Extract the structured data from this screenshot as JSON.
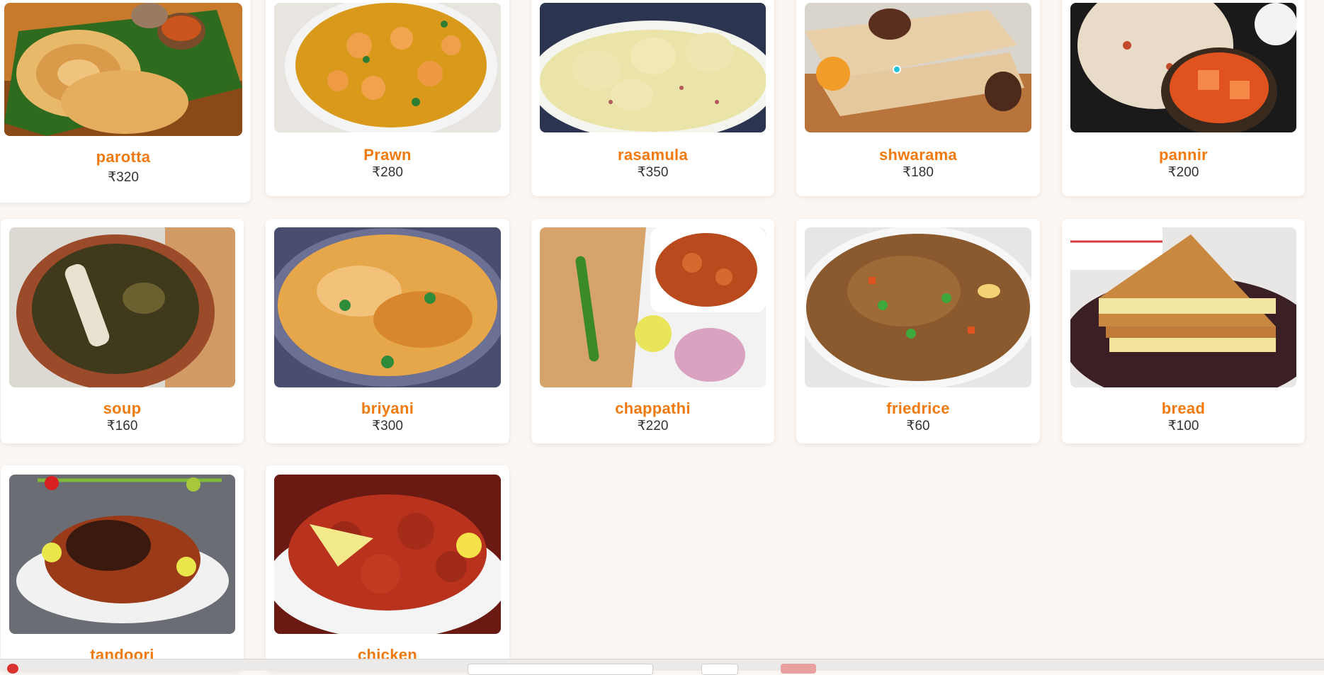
{
  "menu": {
    "currency_symbol": "₹",
    "accent_color": "#f07a10",
    "items": [
      {
        "name": "parotta",
        "price": "₹320",
        "image": "parotta-photo"
      },
      {
        "name": "Prawn",
        "price": "₹280",
        "image": "prawn-curry-photo"
      },
      {
        "name": "rasamula",
        "price": "₹350",
        "image": "rasmalai-photo"
      },
      {
        "name": "shwarama",
        "price": "₹180",
        "image": "shawarma-wrap-photo"
      },
      {
        "name": "pannir",
        "price": "₹200",
        "image": "paneer-naan-photo"
      },
      {
        "name": "soup",
        "price": "₹160",
        "image": "mutton-soup-photo"
      },
      {
        "name": "briyani",
        "price": "₹300",
        "image": "biryani-photo"
      },
      {
        "name": "chappathi",
        "price": "₹220",
        "image": "chapati-curry-photo"
      },
      {
        "name": "friedrice",
        "price": "₹60",
        "image": "fried-rice-photo"
      },
      {
        "name": "bread",
        "price": "₹100",
        "image": "sandwich-photo"
      },
      {
        "name": "tandoori",
        "price": "",
        "image": "tandoori-chicken-photo"
      },
      {
        "name": "chicken",
        "price": "",
        "image": "chicken-fry-photo"
      }
    ]
  }
}
